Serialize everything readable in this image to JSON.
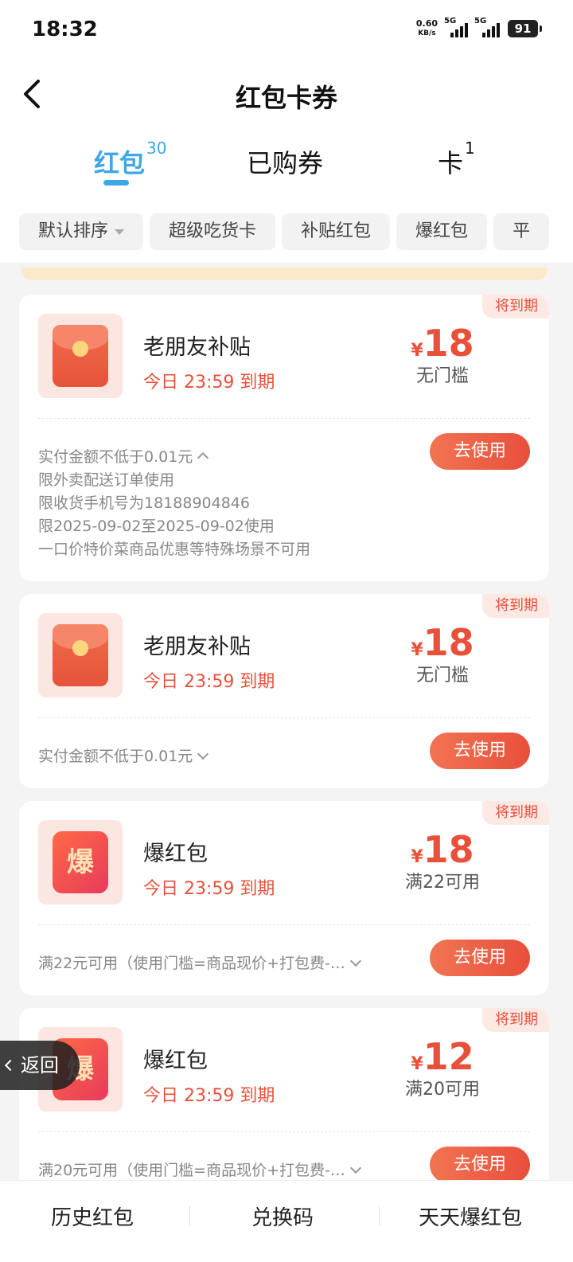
{
  "status_bar": {
    "time": "18:32",
    "net_speed_value": "0.60",
    "net_speed_unit": "KB/s",
    "signal1_label": "5G",
    "signal2_label": "5G",
    "battery": "91"
  },
  "header": {
    "title": "红包卡券"
  },
  "tabs": [
    {
      "label": "红包",
      "count": "30",
      "active": true
    },
    {
      "label": "已购券",
      "count": "",
      "active": false
    },
    {
      "label": "卡",
      "count": "1",
      "active": false
    }
  ],
  "filters": [
    "默认排序",
    "超级吃货卡",
    "补贴红包",
    "爆红包",
    "平"
  ],
  "cards": [
    {
      "badge": "将到期",
      "icon": "red-envelope-icon",
      "name": "老朋友补贴",
      "expiry": "今日 23:59 到期",
      "currency": "¥",
      "amount": "18",
      "condition": "无门槛",
      "desc_lines": [
        "实付金额不低于0.01元",
        "限外卖配送订单使用",
        "限收货手机号为18188904846",
        "限2025-09-02至2025-09-02使用",
        "一口价特价菜商品优惠等特殊场景不可用"
      ],
      "use_label": "去使用"
    },
    {
      "badge": "将到期",
      "icon": "red-envelope-icon",
      "name": "老朋友补贴",
      "expiry": "今日 23:59 到期",
      "currency": "¥",
      "amount": "18",
      "condition": "无门槛",
      "desc_lines": [
        "实付金额不低于0.01元"
      ],
      "use_label": "去使用"
    },
    {
      "badge": "将到期",
      "icon": "bao-hongbao-icon",
      "icon_text": "爆",
      "name": "爆红包",
      "expiry": "今日 23:59 到期",
      "currency": "¥",
      "amount": "18",
      "condition": "满22可用",
      "desc_lines": [
        "满22元可用（使用门槛=商品现价+打包费-…"
      ],
      "use_label": "去使用"
    },
    {
      "badge": "将到期",
      "icon": "bao-hongbao-icon",
      "icon_text": "爆",
      "name": "爆红包",
      "expiry": "今日 23:59 到期",
      "currency": "¥",
      "amount": "12",
      "condition": "满20可用",
      "desc_lines": [
        "满20元可用（使用门槛=商品现价+打包费-…"
      ],
      "use_label": "去使用"
    }
  ],
  "float_back": {
    "label": "返回"
  },
  "bottom_bar": [
    "历史红包",
    "兑换码",
    "天天爆红包"
  ],
  "colors": {
    "accent_blue": "#3fa7e8",
    "accent_red": "#e8503a"
  }
}
